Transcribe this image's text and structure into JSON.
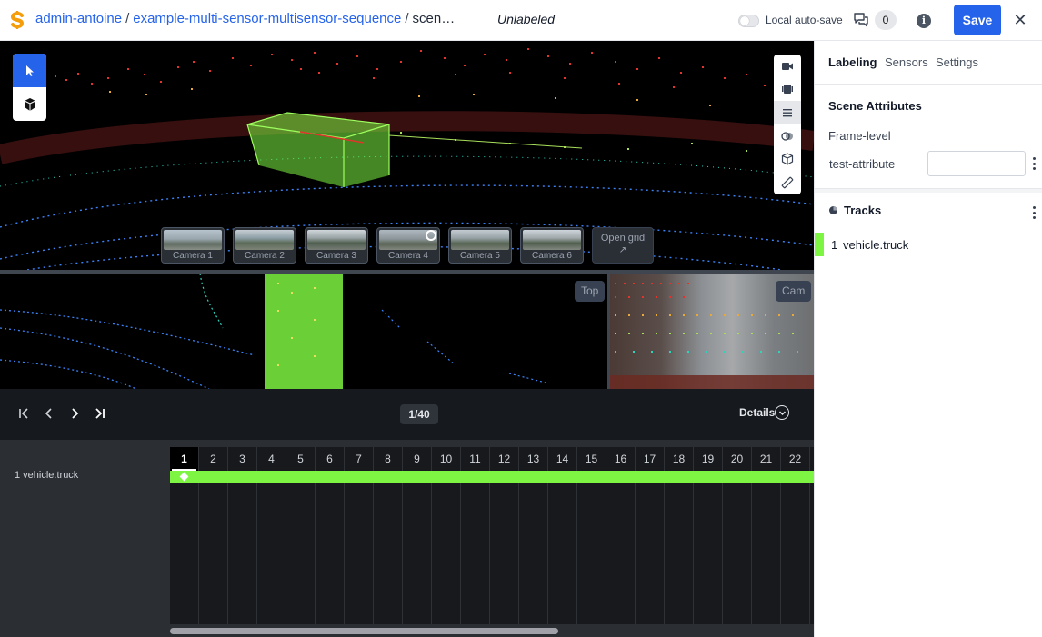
{
  "header": {
    "breadcrumb": {
      "org": "admin-antoine",
      "dataset": "example-multi-sensor-multisensor-sequence",
      "scene": "scen…",
      "separator": "/"
    },
    "status": "Unlabeled",
    "autosave_label": "Local auto-save",
    "autosave_enabled": false,
    "comment_count": "0",
    "info_label": "i",
    "save_label": "Save",
    "close_label": "✕"
  },
  "viewer": {
    "cameras": [
      "Camera 1",
      "Camera 2",
      "Camera 3",
      "Camera 4",
      "Camera 5",
      "Camera 6"
    ],
    "open_grid_label": "Open grid",
    "open_grid_icon": "↗",
    "top_view_label": "Top",
    "cam_view_label": "Cam",
    "cuboid_color": "#7ef542"
  },
  "playback": {
    "frame_counter": "1/40",
    "details_label": "Details"
  },
  "timeline": {
    "track_name": "1 vehicle.truck",
    "frames": [
      "1",
      "2",
      "3",
      "4",
      "5",
      "6",
      "7",
      "8",
      "9",
      "10",
      "11",
      "12",
      "13",
      "14",
      "15",
      "16",
      "17",
      "18",
      "19",
      "20",
      "21",
      "22"
    ],
    "current_frame": "1",
    "track_color": "#7ef542"
  },
  "panel": {
    "tabs": [
      "Labeling",
      "Sensors",
      "Settings"
    ],
    "active_tab": "Labeling",
    "scene_attributes_title": "Scene Attributes",
    "frame_level_title": "Frame-level",
    "attribute_name": "test-attribute",
    "attribute_value": "",
    "tracks_title": "Tracks",
    "track": {
      "id": "1",
      "label": "vehicle.truck",
      "color": "#7ef542"
    }
  },
  "colors": {
    "accent": "#2563eb",
    "viewer_background": "#000000",
    "timeline_background": "#17191c"
  }
}
